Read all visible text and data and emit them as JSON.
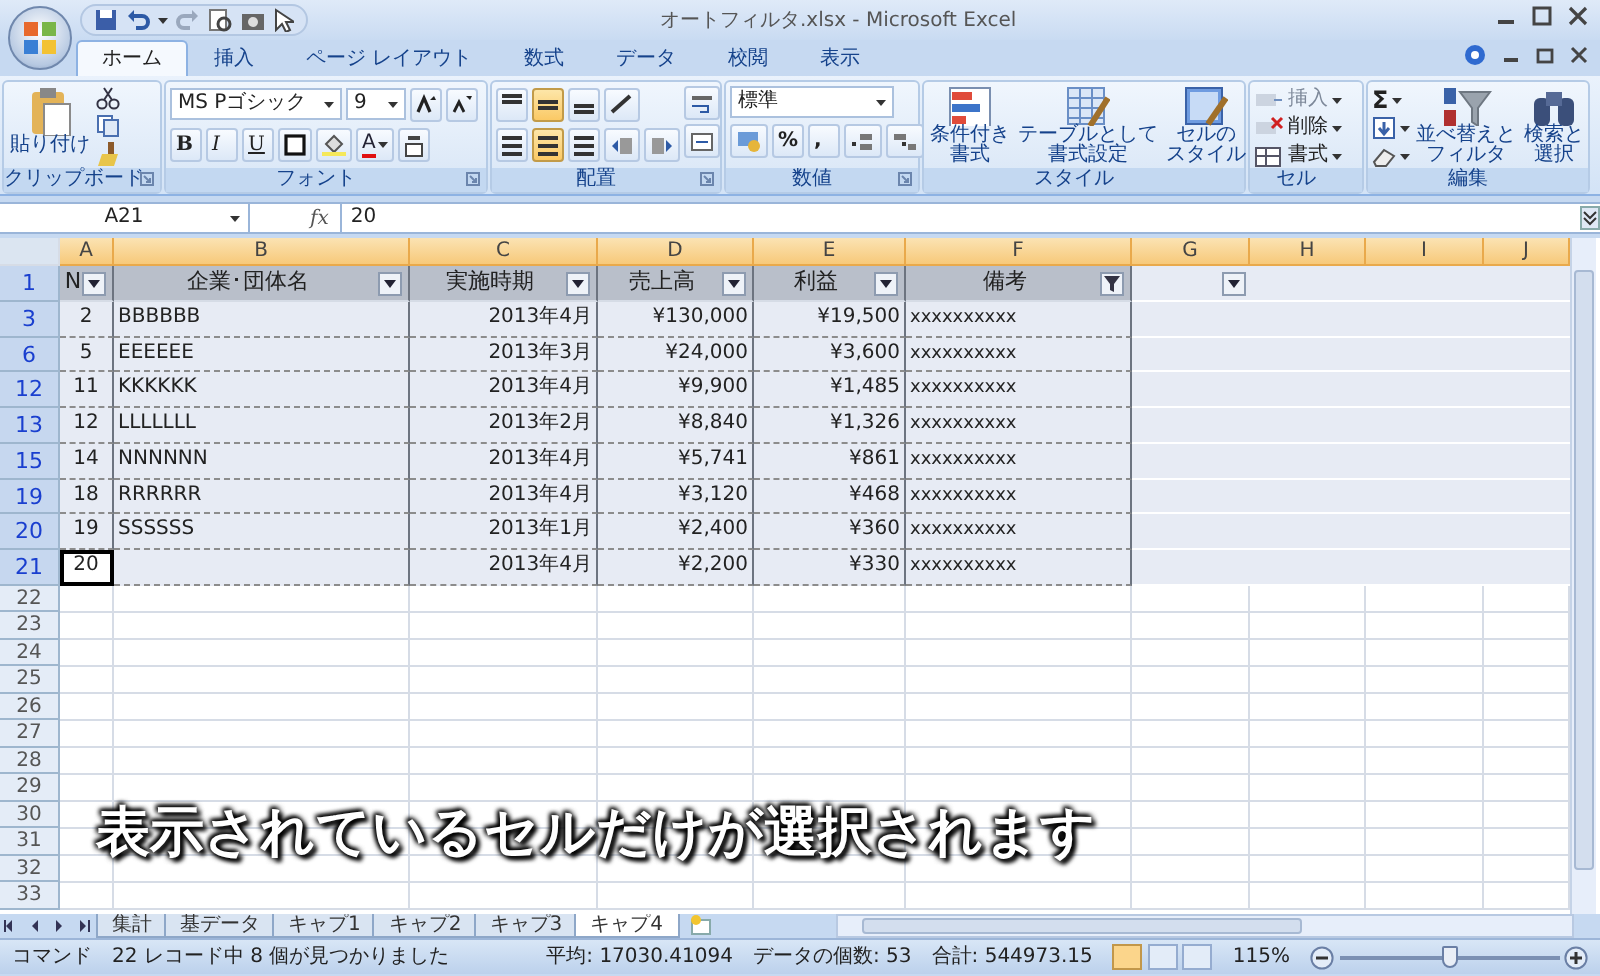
{
  "window": {
    "title": "オートフィルタ.xlsx - Microsoft Excel"
  },
  "ribbon_tabs": [
    {
      "label": "ホーム",
      "selected": true
    },
    {
      "label": "挿入",
      "selected": false
    },
    {
      "label": "ページ レイアウト",
      "selected": false
    },
    {
      "label": "数式",
      "selected": false
    },
    {
      "label": "データ",
      "selected": false
    },
    {
      "label": "校閲",
      "selected": false
    },
    {
      "label": "表示",
      "selected": false
    }
  ],
  "ribbon_groups": [
    {
      "kind": "clipboard",
      "label": "クリップボード",
      "paste_label": "貼り付け"
    },
    {
      "kind": "font",
      "label": "フォント",
      "font_name": "MS Pゴシック",
      "font_size": "9",
      "buttons": [
        "B",
        "I",
        "U"
      ],
      "font_color_label": "A"
    },
    {
      "kind": "alignment",
      "label": "配置"
    },
    {
      "kind": "number",
      "label": "数値",
      "format": "標準",
      "buttons": [
        "%",
        ","
      ]
    },
    {
      "kind": "styles",
      "label": "スタイル",
      "buttons": [
        {
          "lines": [
            "条件付き",
            "書式"
          ]
        },
        {
          "lines": [
            "テーブルとして",
            "書式設定"
          ]
        },
        {
          "lines": [
            "セルの",
            "スタイル"
          ]
        }
      ]
    },
    {
      "kind": "cells",
      "label": "セル",
      "buttons": [
        {
          "label": "挿入",
          "disabled": true
        },
        {
          "label": "削除",
          "disabled": false
        },
        {
          "label": "書式",
          "disabled": false
        }
      ]
    },
    {
      "kind": "editing",
      "label": "編集",
      "sum_label": "Σ",
      "buttons": [
        {
          "lines": [
            "並べ替えと",
            "フィルタ"
          ]
        },
        {
          "lines": [
            "検索と",
            "選択"
          ]
        }
      ]
    }
  ],
  "formula_bar": {
    "name_box": "A21",
    "fx": "fx",
    "value": "20"
  },
  "columns": [
    "A",
    "B",
    "C",
    "D",
    "E",
    "F",
    "G",
    "H",
    "I",
    "J"
  ],
  "header_row": {
    "number": "1",
    "cells": [
      {
        "text": "N",
        "filtered": false
      },
      {
        "text": "企業･団体名",
        "filtered": false
      },
      {
        "text": "実施時期",
        "filtered": false
      },
      {
        "text": "売上高",
        "filtered": false
      },
      {
        "text": "利益",
        "filtered": false
      },
      {
        "text": "備考",
        "filtered": true
      },
      {
        "filtered": false
      }
    ]
  },
  "rows": [
    {
      "number": "3",
      "cells": [
        "2",
        "BBBBBB",
        "2013年4月",
        "¥130,000",
        "¥19,500",
        "xxxxxxxxxx"
      ]
    },
    {
      "number": "6",
      "cells": [
        "5",
        "EEEEEE",
        "2013年3月",
        "¥24,000",
        "¥3,600",
        "xxxxxxxxxx"
      ]
    },
    {
      "number": "12",
      "cells": [
        "11",
        "KKKKKK",
        "2013年4月",
        "¥9,900",
        "¥1,485",
        "xxxxxxxxxx"
      ]
    },
    {
      "number": "13",
      "cells": [
        "12",
        "LLLLLLL",
        "2013年2月",
        "¥8,840",
        "¥1,326",
        "xxxxxxxxxx"
      ]
    },
    {
      "number": "15",
      "cells": [
        "14",
        "NNNNNN",
        "2013年4月",
        "¥5,741",
        "¥861",
        "xxxxxxxxxx"
      ]
    },
    {
      "number": "19",
      "cells": [
        "18",
        "RRRRRR",
        "2013年4月",
        "¥3,120",
        "¥468",
        "xxxxxxxxxx"
      ]
    },
    {
      "number": "20",
      "cells": [
        "19",
        "SSSSSS",
        "2013年1月",
        "¥2,400",
        "¥360",
        "xxxxxxxxxx"
      ]
    },
    {
      "number": "21",
      "cells": [
        "20",
        "",
        "2013年4月",
        "¥2,200",
        "¥330",
        "xxxxxxxxxx"
      ]
    }
  ],
  "empty_rows": [
    "22",
    "23",
    "24",
    "25",
    "26",
    "27",
    "28",
    "29",
    "30",
    "31",
    "32",
    "33"
  ],
  "caption": "表示されているセルだけが選択されます",
  "sheet_tabs": [
    {
      "label": "集計",
      "selected": false
    },
    {
      "label": "基データ",
      "selected": false
    },
    {
      "label": "キャプ1",
      "selected": false
    },
    {
      "label": "キャプ2",
      "selected": false
    },
    {
      "label": "キャプ3",
      "selected": false
    },
    {
      "label": "キャプ4",
      "selected": true
    }
  ],
  "status_bar": {
    "mode": "コマンド",
    "message": "22 レコード中 8 個が見つかりました",
    "average": "平均: 17030.41094",
    "count": "データの個数: 53",
    "sum": "合計: 544973.15",
    "views": [
      {
        "selected": true
      },
      {
        "selected": false
      },
      {
        "selected": false
      }
    ],
    "zoom": "115%",
    "zoom_slider": {
      "level": 0.5
    }
  }
}
